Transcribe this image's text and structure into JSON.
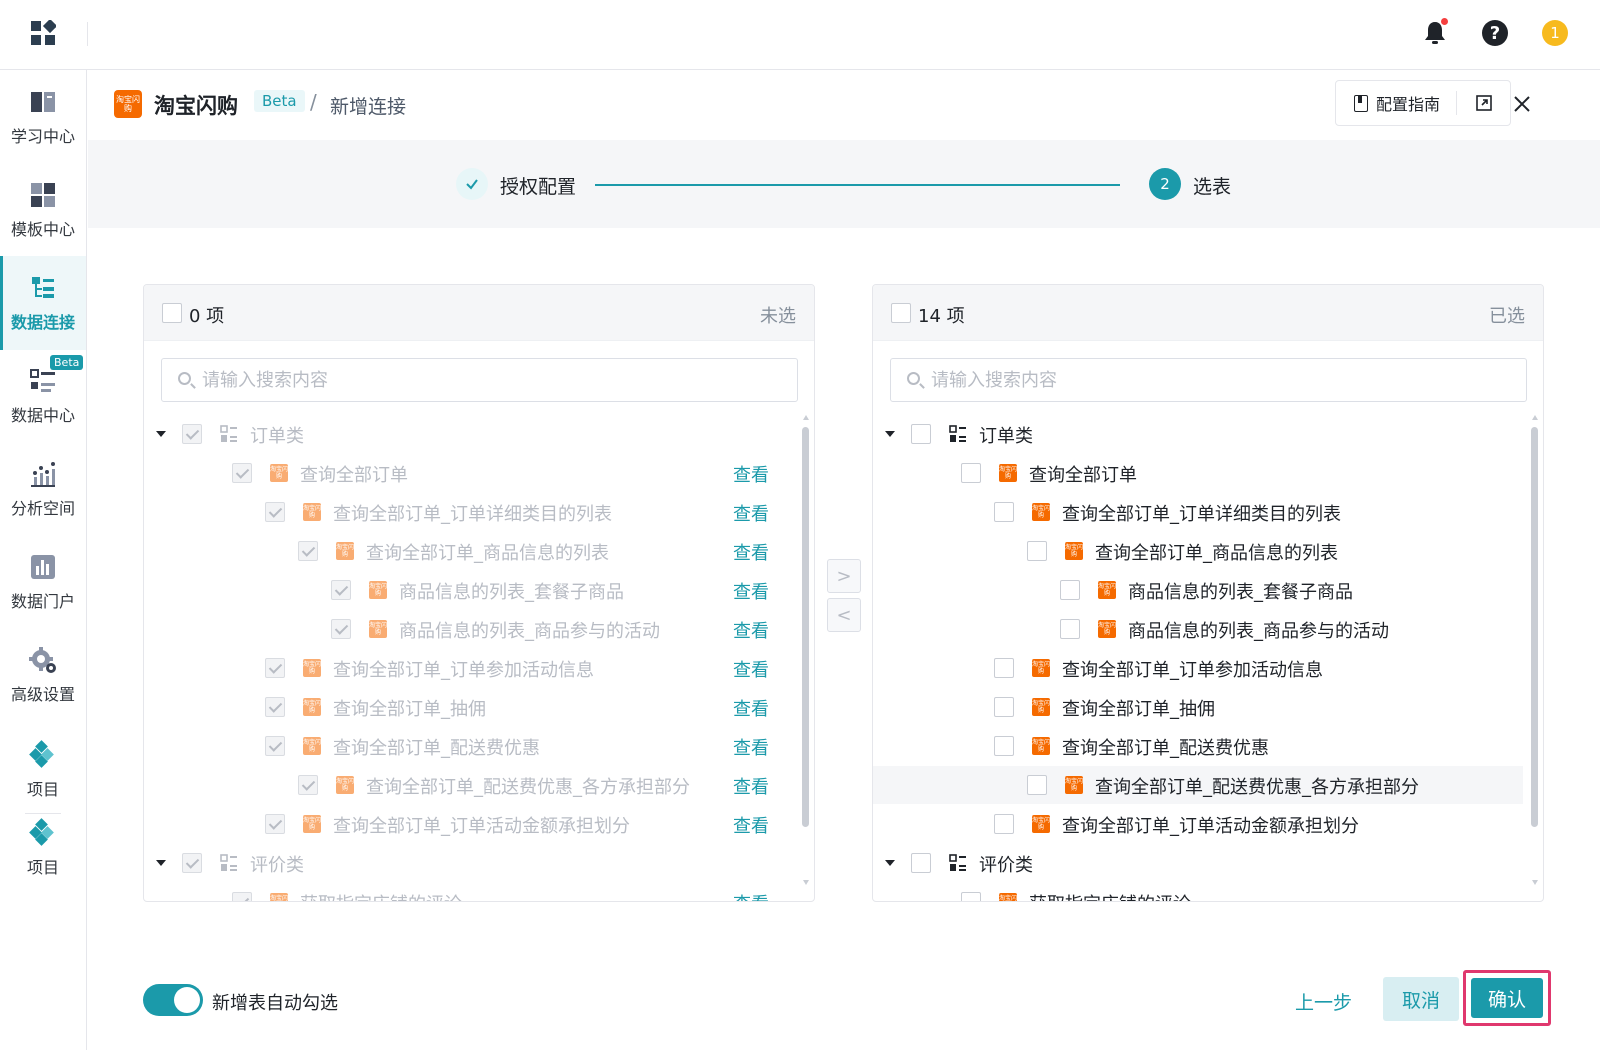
{
  "topbar": {
    "user_initial": "1",
    "help_symbol": "?"
  },
  "sidebar": {
    "items": [
      {
        "label": "学习中心",
        "icon": "book-icon"
      },
      {
        "label": "模板中心",
        "icon": "template-icon"
      },
      {
        "label": "数据连接",
        "icon": "data-connect-icon",
        "active": true
      },
      {
        "label": "数据中心",
        "icon": "data-center-icon",
        "badge": "Beta"
      },
      {
        "label": "分析空间",
        "icon": "analysis-icon"
      },
      {
        "label": "数据门户",
        "icon": "portal-icon"
      },
      {
        "label": "高级设置",
        "icon": "settings-gear-icon"
      },
      {
        "label": "项目",
        "icon": "project-icon"
      },
      {
        "label": "项目",
        "icon": "project-icon"
      }
    ]
  },
  "header": {
    "brand_logo_text": "淘宝闪购",
    "title": "淘宝闪购",
    "beta": "Beta",
    "separator": "/",
    "current": "新增连接",
    "guide_label": "配置指南"
  },
  "steps": [
    {
      "label": "授权配置",
      "status": "done"
    },
    {
      "number": "2",
      "label": "选表",
      "status": "active"
    }
  ],
  "left_panel": {
    "count": "0 项",
    "status": "未选",
    "search_placeholder": "请输入搜索内容",
    "view_label": "查看"
  },
  "right_panel": {
    "count": "14 项",
    "status": "已选",
    "search_placeholder": "请输入搜索内容"
  },
  "tree_rows": [
    {
      "type": "group",
      "label": "订单类"
    },
    {
      "type": "table",
      "label": "查询全部订单",
      "level": 1
    },
    {
      "type": "table",
      "label": "查询全部订单_订单详细类目的列表",
      "level": 2
    },
    {
      "type": "table",
      "label": "查询全部订单_商品信息的列表",
      "level": 3
    },
    {
      "type": "table",
      "label": "商品信息的列表_套餐子商品",
      "level": 4
    },
    {
      "type": "table",
      "label": "商品信息的列表_商品参与的活动",
      "level": 4
    },
    {
      "type": "table",
      "label": "查询全部订单_订单参加活动信息",
      "level": 2
    },
    {
      "type": "table",
      "label": "查询全部订单_抽佣",
      "level": 2
    },
    {
      "type": "table",
      "label": "查询全部订单_配送费优惠",
      "level": 2
    },
    {
      "type": "table",
      "label": "查询全部订单_配送费优惠_各方承担部分",
      "level": 3
    },
    {
      "type": "table",
      "label": "查询全部订单_订单活动金额承担划分",
      "level": 2
    },
    {
      "type": "group",
      "label": "评价类"
    },
    {
      "type": "table",
      "label": "获取指定店铺的评论",
      "level": 1
    }
  ],
  "transfer": {
    "to_right": ">",
    "to_left": "<"
  },
  "footer": {
    "auto_select_label": "新增表自动勾选",
    "auto_select_on": true,
    "prev_label": "上一步",
    "cancel_label": "取消",
    "confirm_label": "确认"
  },
  "colors": {
    "accent": "#1b9aaa",
    "brand_orange": "#f56a00",
    "confirm_highlight": "#e0386e"
  }
}
